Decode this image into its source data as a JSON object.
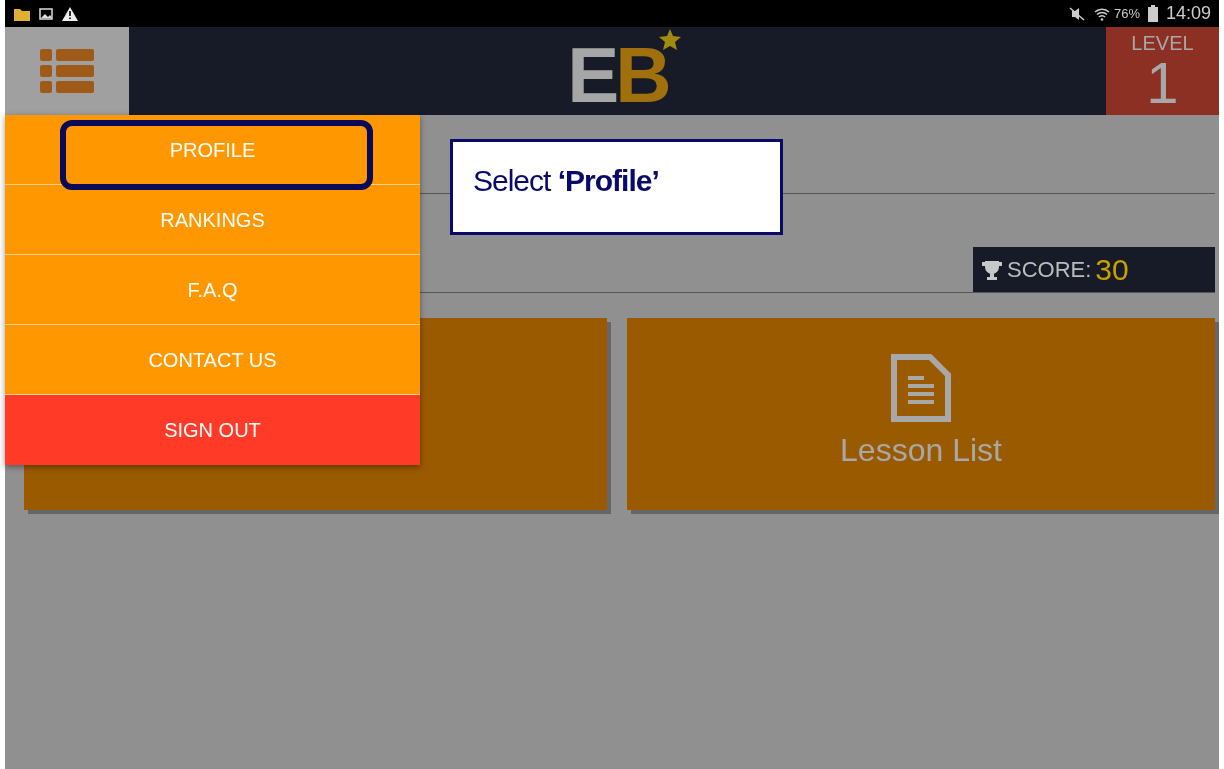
{
  "status_bar": {
    "battery": "76%",
    "time": "14:09"
  },
  "header": {
    "logo": "EB",
    "level_label": "LEVEL",
    "level_value": "1"
  },
  "score": {
    "label": "SCORE:",
    "value": "30"
  },
  "cards": [
    {
      "label": "Lesson List"
    }
  ],
  "menu": [
    {
      "label": "PROFILE",
      "kind": "normal",
      "highlighted": true
    },
    {
      "label": "RANKINGS",
      "kind": "normal",
      "highlighted": false
    },
    {
      "label": "F.A.Q",
      "kind": "normal",
      "highlighted": false
    },
    {
      "label": "CONTACT US",
      "kind": "normal",
      "highlighted": false
    },
    {
      "label": "SIGN OUT",
      "kind": "danger",
      "highlighted": false
    }
  ],
  "annotation": {
    "text": "Select **‘Profile’**"
  }
}
